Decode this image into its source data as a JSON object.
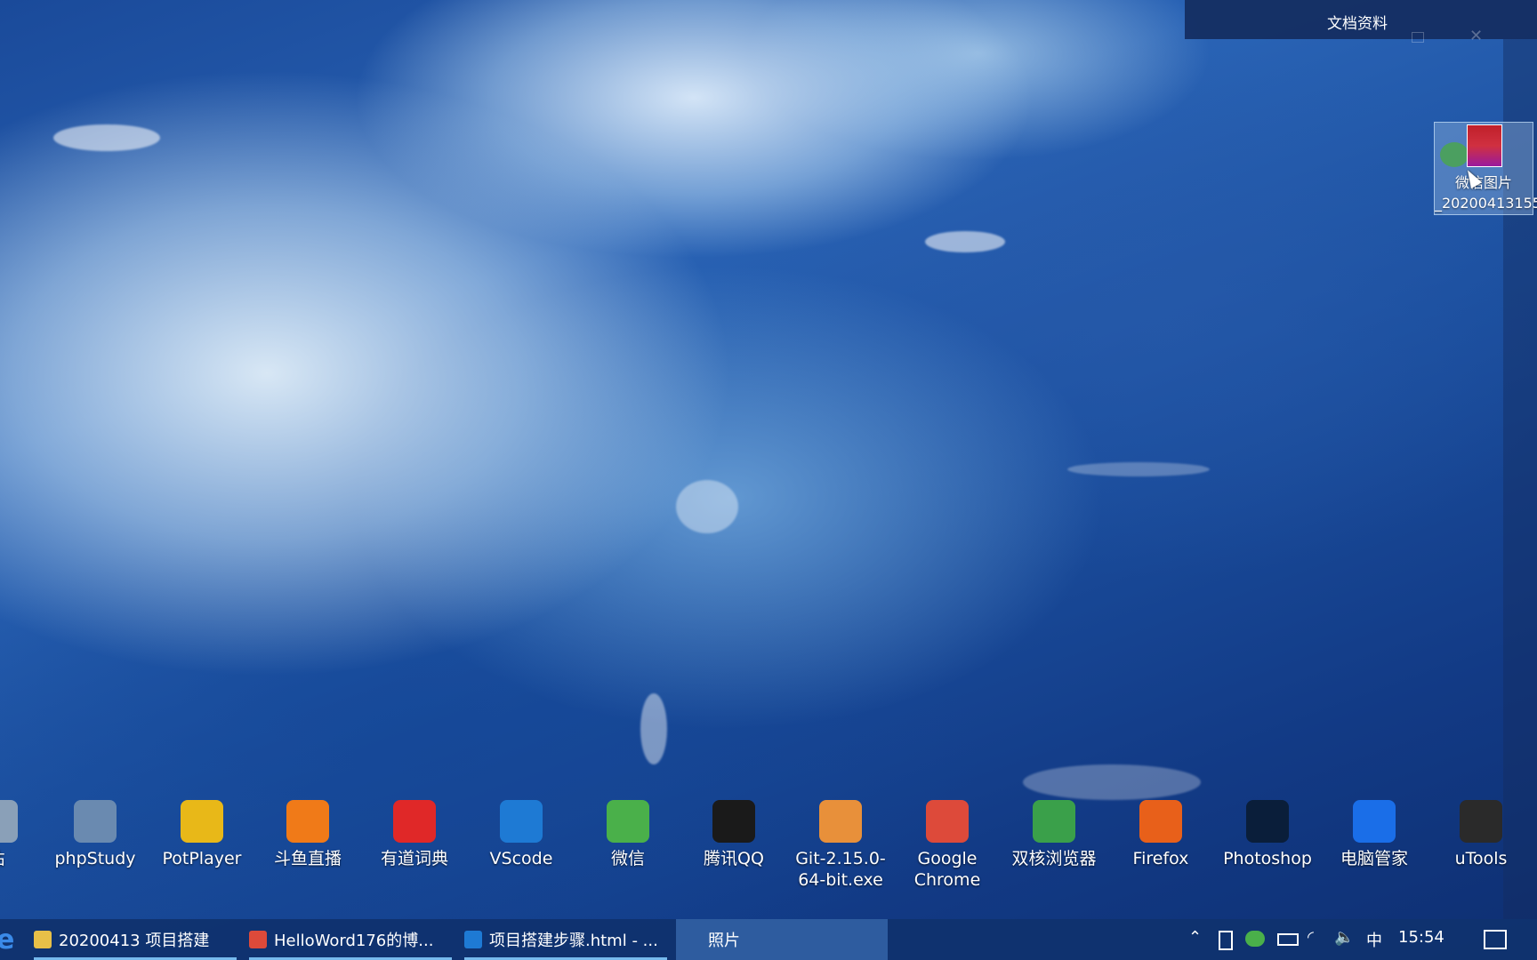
{
  "window": {
    "title": "文档资料"
  },
  "desktop_file": {
    "name": "微信图片_20200413155..."
  },
  "desktop_icons": [
    {
      "label": "站",
      "icon": "recycle-bin-icon",
      "color": "#8aa0b8"
    },
    {
      "label": "phpStudy",
      "icon": "phpstudy-icon",
      "color": "#6a8ab0"
    },
    {
      "label": "PotPlayer",
      "icon": "potplayer-icon",
      "color": "#e8b818"
    },
    {
      "label": "斗鱼直播",
      "icon": "douyu-icon",
      "color": "#f07a18"
    },
    {
      "label": "有道词典",
      "icon": "youdao-icon",
      "color": "#e02828"
    },
    {
      "label": "VScode",
      "icon": "vscode-icon",
      "color": "#1e7ad4"
    },
    {
      "label": "微信",
      "icon": "wechat-icon",
      "color": "#4ab04a"
    },
    {
      "label": "腾讯QQ",
      "icon": "qq-icon",
      "color": "#1a1a1a"
    },
    {
      "label": "Git-2.15.0-64-bit.exe",
      "icon": "git-icon",
      "color": "#e8903a"
    },
    {
      "label": "Google Chrome",
      "icon": "chrome-icon",
      "color": "#dd4a3a"
    },
    {
      "label": "双核浏览器",
      "icon": "dual-core-browser-icon",
      "color": "#3aa04a"
    },
    {
      "label": "Firefox",
      "icon": "firefox-icon",
      "color": "#e8601a"
    },
    {
      "label": "Photoshop",
      "icon": "photoshop-icon",
      "color": "#0a1e3a"
    },
    {
      "label": "电脑管家",
      "icon": "pc-manager-icon",
      "color": "#1a6ee8"
    },
    {
      "label": "uTools",
      "icon": "utools-icon",
      "color": "#2a2a2a"
    }
  ],
  "taskbar": {
    "tasks": [
      {
        "label": "20200413 项目搭建",
        "icon": "folder-icon",
        "color": "#e8c048"
      },
      {
        "label": "HelloWord176的博...",
        "icon": "chrome-icon",
        "color": "#dd4a3a"
      },
      {
        "label": "项目搭建步骤.html - ...",
        "icon": "vscode-icon",
        "color": "#1e7ad4"
      },
      {
        "label": "照片",
        "icon": "photos-icon",
        "color": "#2a6ab8"
      }
    ],
    "tray": {
      "ime": "中",
      "time": "15:54"
    }
  }
}
